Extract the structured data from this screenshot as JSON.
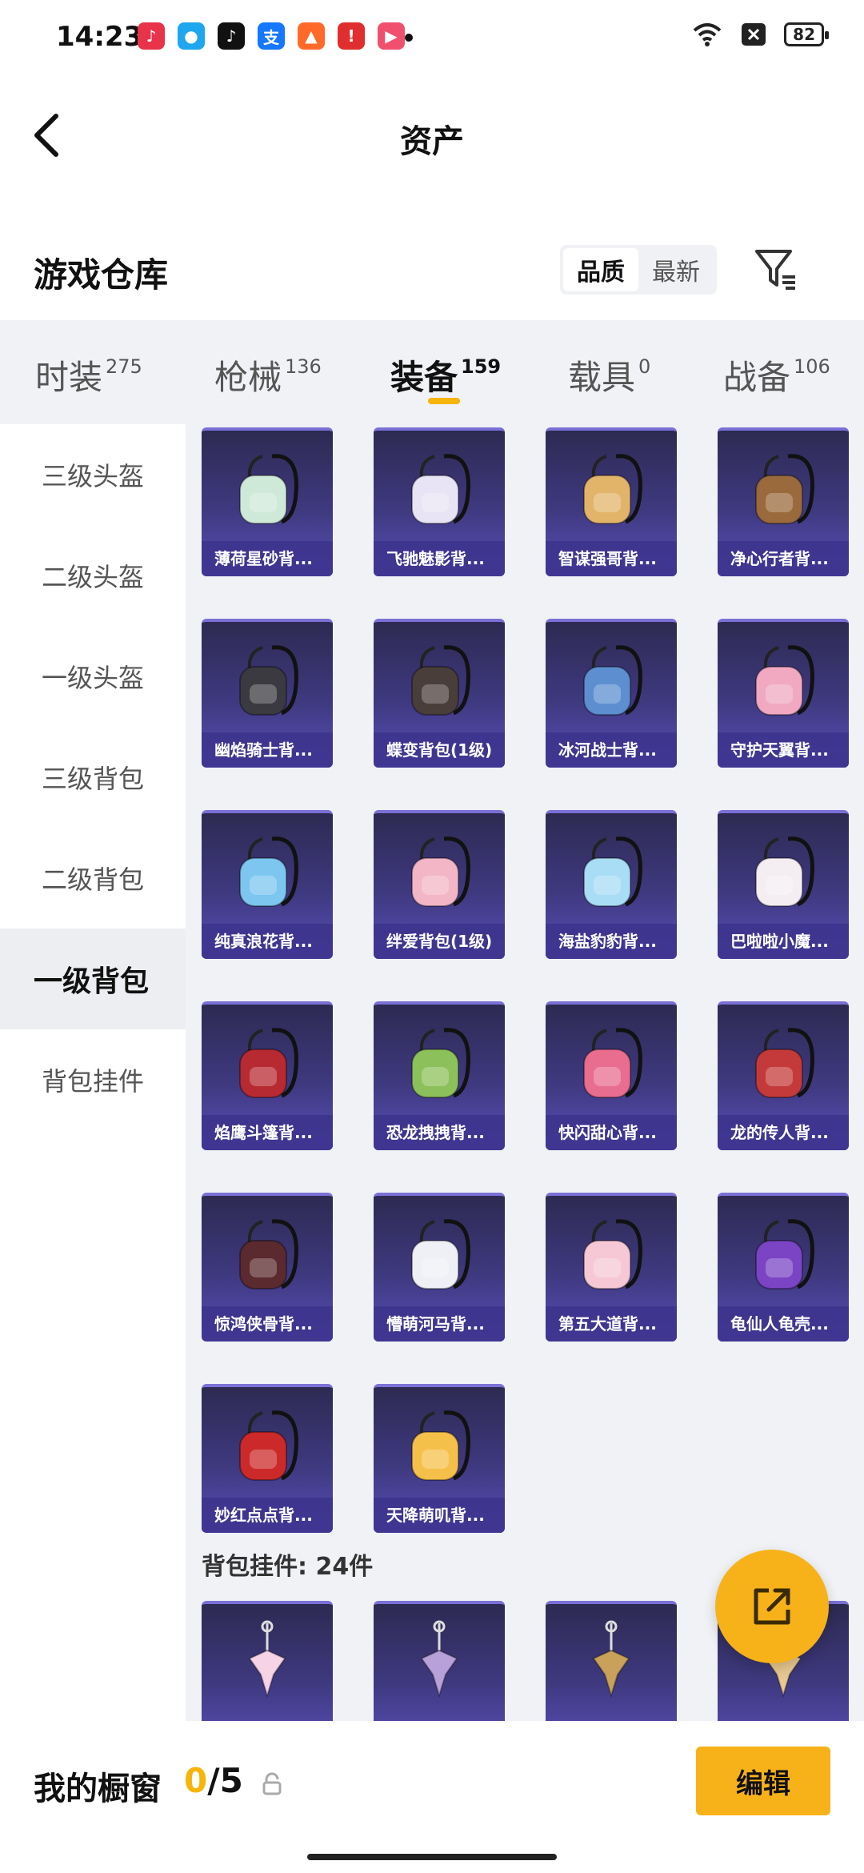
{
  "status_bar": {
    "time": "14:23",
    "battery": "82",
    "app_icons": [
      {
        "icon": "music-app-icon",
        "color": "#e8334a",
        "glyph": "♪"
      },
      {
        "icon": "qq-app-icon",
        "color": "#1ea7ee",
        "glyph": "●"
      },
      {
        "icon": "tiktok-app-icon",
        "color": "#111111",
        "glyph": "♪"
      },
      {
        "icon": "alipay-app-icon",
        "color": "#1677ff",
        "glyph": "支"
      },
      {
        "icon": "game-app-icon",
        "color": "#ff6a2b",
        "glyph": "▲"
      },
      {
        "icon": "red-app-icon",
        "color": "#e02e2e",
        "glyph": "!"
      },
      {
        "icon": "video-app-icon",
        "color": "#f0506e",
        "glyph": "▶"
      }
    ]
  },
  "header": {
    "title": "资产"
  },
  "warehouse": {
    "title": "游戏仓库",
    "sort_options": [
      {
        "label": "品质",
        "active": true
      },
      {
        "label": "最新",
        "active": false
      }
    ]
  },
  "tabs": [
    {
      "label": "时装",
      "count": "275",
      "active": false
    },
    {
      "label": "枪械",
      "count": "136",
      "active": false
    },
    {
      "label": "装备",
      "count": "159",
      "active": true
    },
    {
      "label": "载具",
      "count": "0",
      "active": false
    },
    {
      "label": "战备",
      "count": "106",
      "active": false
    }
  ],
  "sidebar": {
    "items": [
      {
        "label": "三级头盔",
        "active": false
      },
      {
        "label": "二级头盔",
        "active": false
      },
      {
        "label": "一级头盔",
        "active": false
      },
      {
        "label": "三级背包",
        "active": false
      },
      {
        "label": "二级背包",
        "active": false
      },
      {
        "label": "一级背包",
        "active": true
      },
      {
        "label": "背包挂件",
        "active": false
      }
    ]
  },
  "items": [
    {
      "name": "薄荷星砂背...",
      "color": "#cfe9d8"
    },
    {
      "name": "飞驰魅影背...",
      "color": "#e9e4f5"
    },
    {
      "name": "智谋强哥背...",
      "color": "#e2b46a"
    },
    {
      "name": "净心行者背...",
      "color": "#9a6a3c"
    },
    {
      "name": "幽焰骑士背...",
      "color": "#3a3a40"
    },
    {
      "name": "蝶变背包(1级)",
      "color": "#4a3e3a"
    },
    {
      "name": "冰河战士背...",
      "color": "#5d8fd0"
    },
    {
      "name": "守护天翼背...",
      "color": "#f1a9c2"
    },
    {
      "name": "纯真浪花背...",
      "color": "#7cc6ef"
    },
    {
      "name": "绊爱背包(1级)",
      "color": "#f3b6c6"
    },
    {
      "name": "海盐豹豹背...",
      "color": "#a9ddf5"
    },
    {
      "name": "巴啦啦小魔...",
      "color": "#f4eef3"
    },
    {
      "name": "焰鹰斗篷背...",
      "color": "#b82a32"
    },
    {
      "name": "恐龙拽拽背...",
      "color": "#8cc05a"
    },
    {
      "name": "快闪甜心背...",
      "color": "#e86d8e"
    },
    {
      "name": "龙的传人背...",
      "color": "#c43a3a"
    },
    {
      "name": "惊鸿侠骨背...",
      "color": "#5a2a2e"
    },
    {
      "name": "懵萌河马背...",
      "color": "#eef0f6"
    },
    {
      "name": "第五大道背...",
      "color": "#f6c8d6"
    },
    {
      "name": "龟仙人龟壳...",
      "color": "#7a44c4"
    },
    {
      "name": "妙红点点背...",
      "color": "#cc2a2a"
    },
    {
      "name": "天降萌叽背...",
      "color": "#f5c04a"
    }
  ],
  "charm_section": {
    "label": "背包挂件: 24件",
    "items": [
      {
        "color": "#f7d3e6"
      },
      {
        "color": "#b8a0d8"
      },
      {
        "color": "#c9a15a"
      },
      {
        "color": "#e8c890"
      }
    ]
  },
  "bottom_bar": {
    "title": "我的橱窗",
    "current": "0",
    "total": "/5",
    "edit_label": "编辑"
  }
}
